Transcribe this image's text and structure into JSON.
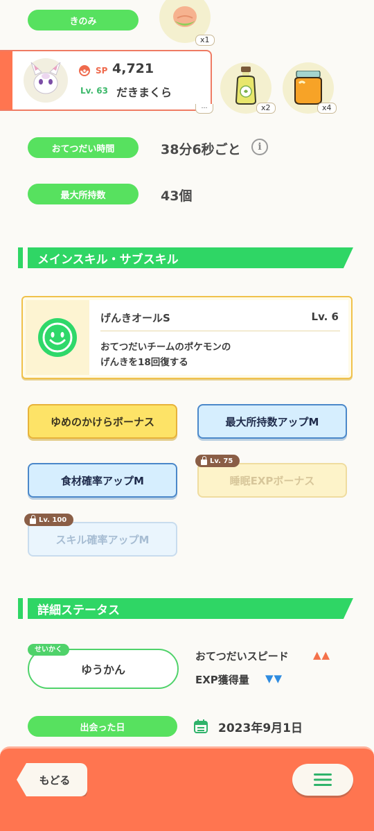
{
  "top": {
    "berry_label": "きのみ",
    "berry_qty": "x1"
  },
  "pokemon": {
    "sp_label": "SP",
    "sp_value": "4,721",
    "level": "Lv. 63",
    "name": "だきまくら"
  },
  "ingredients": [
    {
      "name": "oil-bottle-icon",
      "qty": "x2"
    },
    {
      "name": "honey-jar-icon",
      "qty": "x4"
    }
  ],
  "stats": {
    "help_time_label": "おてつだい時間",
    "help_time_value": "38分6秒ごと",
    "max_carry_label": "最大所持数",
    "max_carry_value": "43個"
  },
  "skills_section": {
    "title": "メインスキル・サブスキル",
    "main_skill": {
      "name": "げんきオールS",
      "level": "Lv. 6",
      "description_line1": "おてつだいチームのポケモンの",
      "description_line2": "げんきを18回復する"
    },
    "sub_skills": [
      {
        "label": "ゆめのかけらボーナス",
        "style": "yellow",
        "locked": false
      },
      {
        "label": "最大所持数アップM",
        "style": "blue",
        "locked": false
      },
      {
        "label": "食材確率アップM",
        "style": "blue",
        "locked": false
      },
      {
        "label": "睡眠EXPボーナス",
        "style": "yellow",
        "locked": true,
        "lock_level": "Lv. 75"
      },
      {
        "label": "スキル確率アップM",
        "style": "blue",
        "locked": true,
        "lock_level": "Lv. 100"
      }
    ]
  },
  "details_section": {
    "title": "詳細ステータス",
    "nature_tag": "せいかく",
    "nature_value": "ゆうかん",
    "up_label": "おてつだいスピード",
    "up_marks": "▲▲",
    "down_label": "EXP獲得量",
    "down_marks": "▼▼",
    "met_date_label": "出会った日",
    "met_date_value": "2023年9月1日"
  },
  "footer": {
    "back_label": "もどる"
  },
  "colors": {
    "accent_green": "#57e15f",
    "section_green": "#2fd665",
    "footer_orange": "#ff7550",
    "up_color": "#f4714a",
    "down_color": "#2f8ce0"
  }
}
